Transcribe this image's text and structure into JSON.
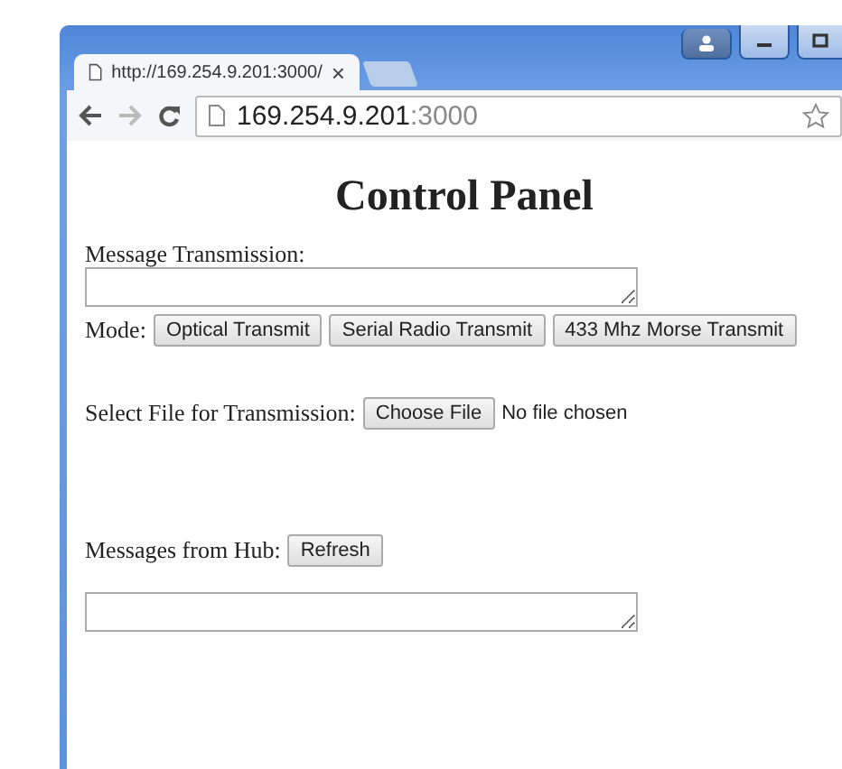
{
  "browser": {
    "tab": {
      "title": "http://169.254.9.201:3000/",
      "close": "×"
    },
    "address": {
      "host": "169.254.9.201",
      "port": ":3000"
    }
  },
  "page": {
    "heading": "Control Panel",
    "message": {
      "label": "Message Transmission:"
    },
    "mode": {
      "label": "Mode:",
      "buttons": [
        "Optical Transmit",
        "Serial Radio Transmit",
        "433 Mhz Morse Transmit"
      ]
    },
    "file": {
      "label": "Select File for Transmission:",
      "button": "Choose File",
      "status": "No file chosen"
    },
    "hub": {
      "label": "Messages from Hub:",
      "button": "Refresh"
    }
  }
}
